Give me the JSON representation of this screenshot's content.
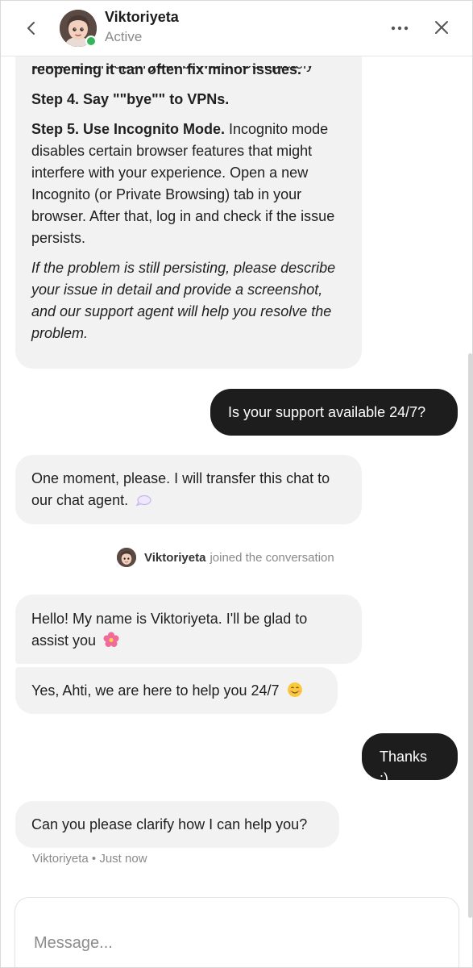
{
  "header": {
    "agent_name": "Viktoriyeta",
    "status": "Active"
  },
  "messages": {
    "m1": {
      "partial_line": "reopening it can often fix minor issues.",
      "step4": "Step 4. Say \"\"bye\"\" to VPNs.",
      "step5_title": "Step 5. Use Incognito Mode.",
      "step5_body": " Incognito mode disables certain browser features that might interfere with your experience. Open a new Incognito (or Private Browsing) tab in your browser. After that, log in and check if the issue persists.",
      "note": "If the problem is still persisting, please describe your issue in detail and provide a screenshot, and our support agent will help you resolve the problem."
    },
    "m2": "Is your support available 24/7?",
    "m3": "One moment, please. I will transfer this chat to our chat agent.",
    "join": {
      "name": "Viktoriyeta",
      "text": "joined the conversation"
    },
    "m4": "Hello! My name is Viktoriyeta. I'll be glad to assist you",
    "m5": "Yes, Ahti, we are here to help you 24/7",
    "m6": "Thanks :)",
    "m7": "Can you please clarify how I can help you?",
    "meta": "Viktoriyeta • Just now"
  },
  "composer": {
    "placeholder": "Message..."
  },
  "icons": {
    "back": "chevron-left-icon",
    "more": "more-horizontal-icon",
    "close": "close-icon",
    "speech": "speech-bubble-emoji",
    "flower": "flower-emoji",
    "smile": "smiling-face-emoji"
  },
  "colors": {
    "user_bubble": "#1d1d1d",
    "agent_bubble": "#f2f2f2",
    "online": "#35b55b"
  }
}
